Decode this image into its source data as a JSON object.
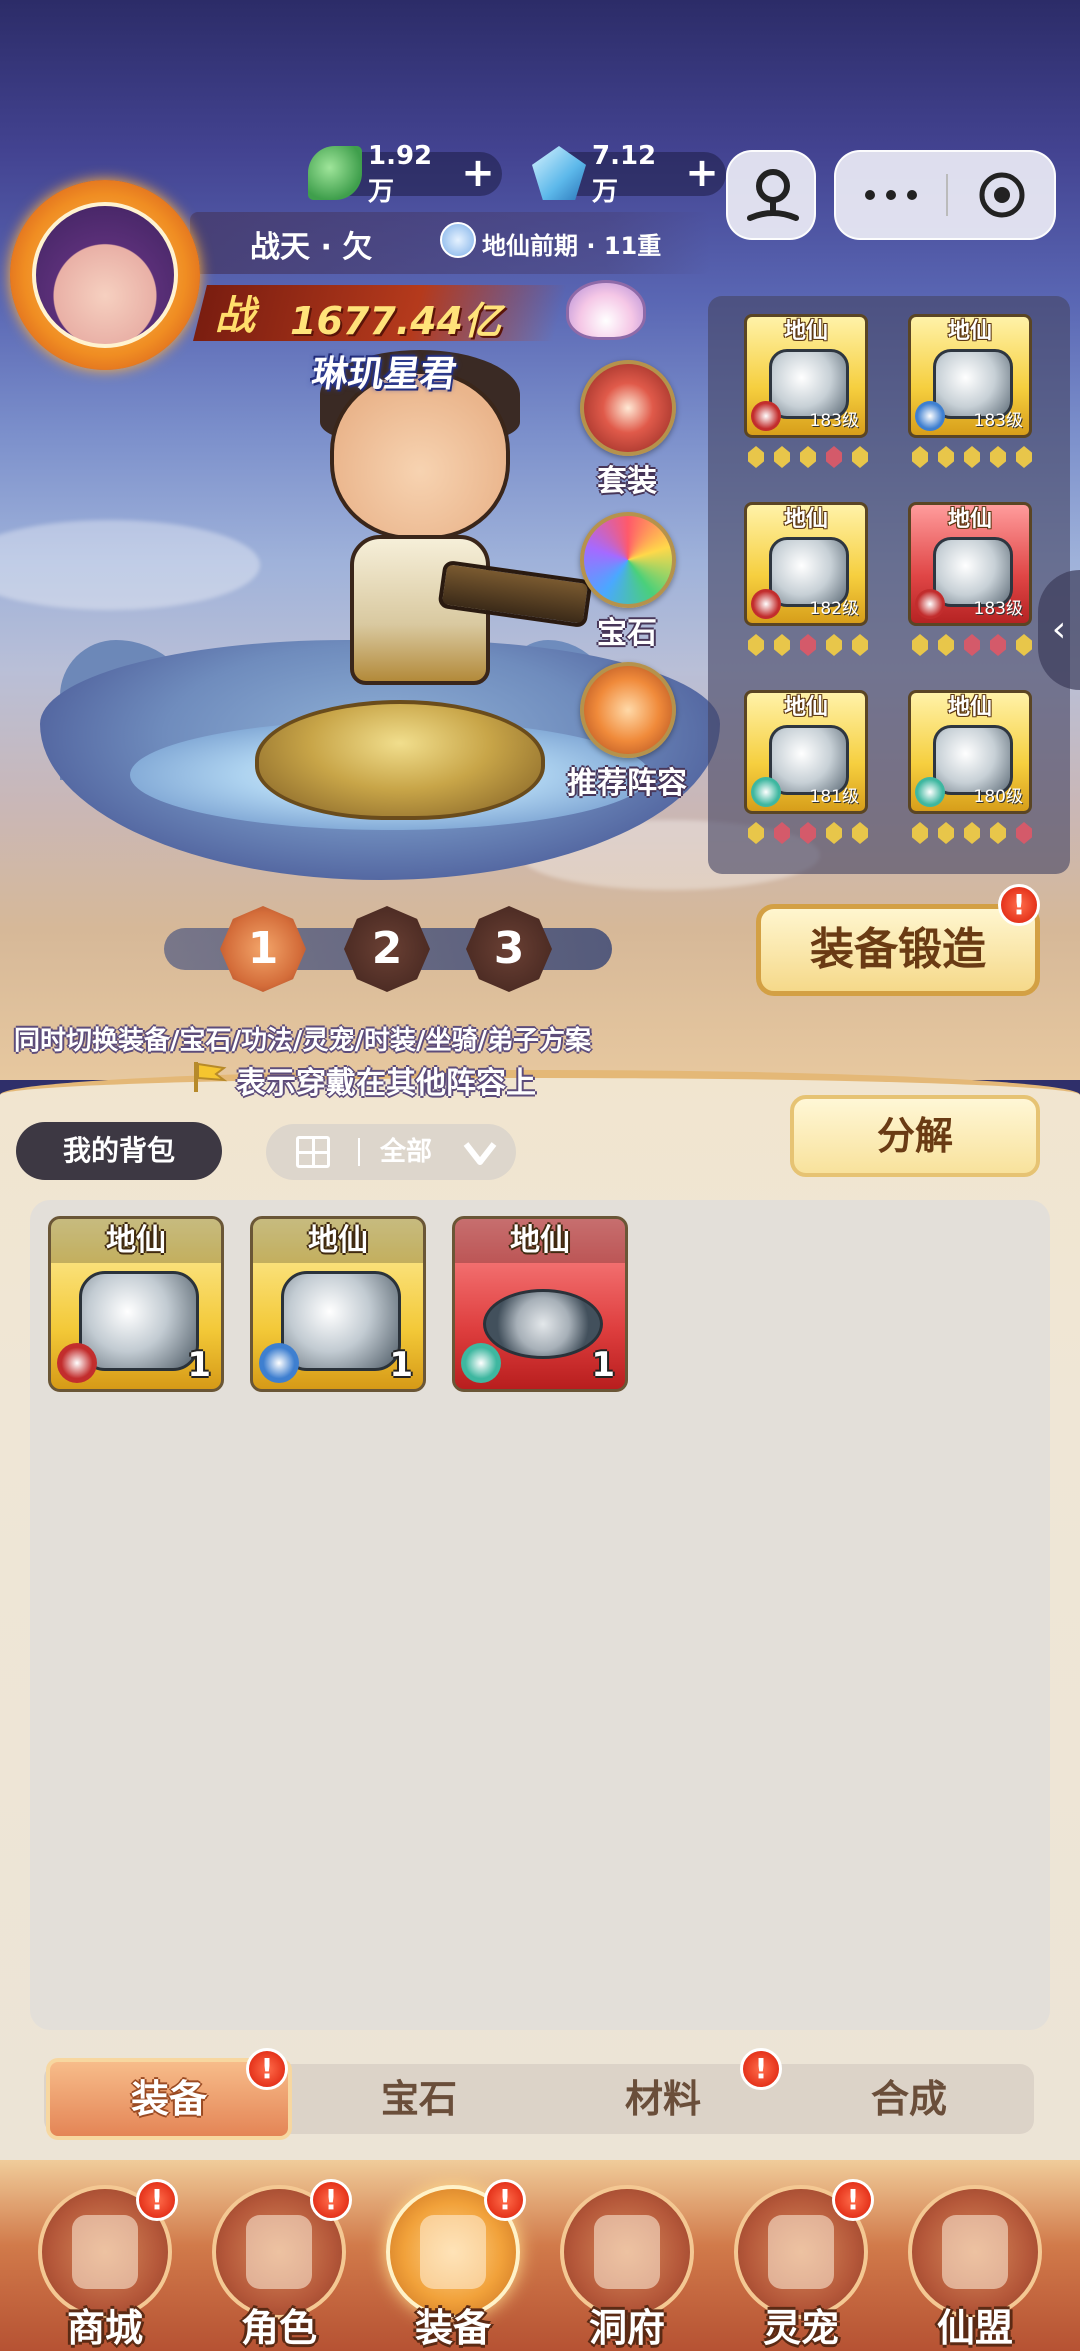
{
  "currencies": [
    {
      "name": "jade-leaf",
      "amount": "1.92万",
      "color": "#4fb860"
    },
    {
      "name": "spirit-crystal",
      "amount": "7.12万",
      "color": "#6fc4ef"
    }
  ],
  "profile": {
    "name": "战天 · 欠",
    "realm": "地仙前期 · 11重",
    "power_label": "战",
    "power_value": "1677.44亿",
    "hero_title": "琳玑星君"
  },
  "features": [
    {
      "label": "套装",
      "icon": "fist-shield-icon",
      "color": "#c93a2e"
    },
    {
      "label": "宝石",
      "icon": "gem-orb-icon",
      "color": "#8c6be0"
    },
    {
      "label": "推荐阵容",
      "icon": "thumbs-up-icon",
      "color": "#e88a3a"
    }
  ],
  "equipment": [
    {
      "tier": "地仙",
      "level": "183级",
      "rarity": "gold",
      "item": "sword",
      "badge": "#c22d2d",
      "gems": [
        "#e8c64a",
        "#e8c64a",
        "#e8c64a",
        "#d45a6a",
        "#e8c64a"
      ]
    },
    {
      "tier": "地仙",
      "level": "183级",
      "rarity": "gold",
      "item": "armor",
      "badge": "#3e7fd0",
      "gems": [
        "#e8c64a",
        "#e8c64a",
        "#e8c64a",
        "#e8c64a",
        "#e8c64a"
      ]
    },
    {
      "tier": "地仙",
      "level": "182级",
      "rarity": "gold",
      "item": "helmet",
      "badge": "#c22d2d",
      "gems": [
        "#e8c64a",
        "#e8c64a",
        "#d45a6a",
        "#e8c64a",
        "#e8c64a"
      ]
    },
    {
      "tier": "地仙",
      "level": "183级",
      "rarity": "red",
      "item": "belt",
      "badge": "#c22d2d",
      "gems": [
        "#e8c64a",
        "#e8c64a",
        "#d45a6a",
        "#d45a6a",
        "#e8c64a"
      ]
    },
    {
      "tier": "地仙",
      "level": "181级",
      "rarity": "gold",
      "item": "ring",
      "badge": "#3eb7a0",
      "gems": [
        "#e8c64a",
        "#d45a6a",
        "#d45a6a",
        "#e8c64a",
        "#e8c64a"
      ]
    },
    {
      "tier": "地仙",
      "level": "180级",
      "rarity": "gold",
      "item": "boots",
      "badge": "#3eb7a0",
      "gems": [
        "#e8c64a",
        "#e8c64a",
        "#e8c64a",
        "#e8c64a",
        "#d45a6a"
      ]
    }
  ],
  "loadouts": [
    "1",
    "2",
    "3"
  ],
  "forge_label": "装备锻造",
  "info": {
    "line1": "同时切换装备/宝石/功法/灵宠/时装/坐骑/弟子方案",
    "line2": "表示穿戴在其他阵容上"
  },
  "bag": {
    "label": "我的背包",
    "filter": "全部",
    "decompose": "分解",
    "items": [
      {
        "tier": "地仙",
        "count": "1",
        "rarity": "gold",
        "item": "boots",
        "badge": "#c22d2d"
      },
      {
        "tier": "地仙",
        "count": "1",
        "rarity": "gold",
        "item": "boots",
        "badge": "#3e7fd0"
      },
      {
        "tier": "地仙",
        "count": "1",
        "rarity": "red",
        "item": "belt",
        "badge": "#3eb7a0"
      }
    ]
  },
  "categories": [
    "装备",
    "宝石",
    "材料",
    "合成"
  ],
  "nav": [
    "商城",
    "角色",
    "装备",
    "洞府",
    "灵宠",
    "仙盟"
  ]
}
